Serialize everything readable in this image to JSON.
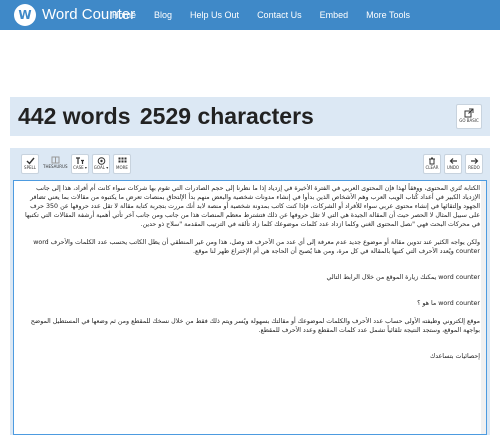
{
  "header": {
    "logo_letter": "W",
    "brand": "Word Counter",
    "nav": [
      "Home",
      "Blog",
      "Help Us Out",
      "Contact Us",
      "Embed",
      "More Tools"
    ]
  },
  "counter": {
    "words": "442 words",
    "characters": "2529 characters",
    "goto_label": "GO BASIC"
  },
  "toolbar": {
    "spell": "SPELL",
    "thesaurus": "THESAURUS",
    "case": "CASE ▾",
    "goal": "GOAL ▾",
    "more": "MORE",
    "clear": "CLEAR",
    "undo": "UNDO",
    "redo": "REDO"
  },
  "editor": {
    "p1": "الكتابة تُثري المحتوى، ووفقاً لهذا فإن المحتوى العربي في الفترة الأخيرة في إزدياد إذا ما نظرنا إلى حجم الصادرات التي تقوم بها شركات سواء كانت أم أفراد، هذا إلى جانب الإزدياد الكبير في أعداد كُتاب الويب العرب وهم الأشخاص الذين بدأوا في إنشاء مدونات شخصية والبعض منهم بدأ الإلتحاق بمنصات تعرض ما يكتبوه من مقالات بما يعني تضافر الجهود وإلتقائها في إنشاء محتوى عربي سواء للأفراد أو الشركات، فإذا كنت كاتب بمدونة شخصية أو منصة لابد أنك مررت بتجربة كتابة مقالة لا تقل عدد حروفها عن 350 حرف على سبيل المثال لا الحصر حيث أن المقالة الجيدة هي التي لا تقل حروفها عن ذلك فتشترط معظم المنصات هذا من جانب ومن جانب آخر تأتي أهمية أرشفة المقالات التي تكتبها في محركات البحث فهي \"نصل المحتوى الغني وكلما ازداد عدد كلمات موضوعك كلما زاد تألقه في الترتيب المقدمة \"سلاح ذو حدين.",
    "p2": "ولكن يواجه الكثير عند تدوين مقالة أو موضوع جديد عدم معرفة إلى أي عدد من الأحرف قد وصل، هذا ومن غير المنطقي أن يظل الكاتب يحسب عدد الكلمات والأحرف word counter ويُعدد الأحرف التي كتبها بالمقالة في كل مرة، ومن هنا يُصبح أن الحاجة هي أم الإختراع ظهر لنا موقع.",
    "p3": "word counter يمكنك زيارة الموقع من خلال الرابط التالي",
    "p4": "word counter ما هو ؟",
    "p5": "موقع إلكتروني وظيفته الأولى حساب عدد الأحرف والكلمات لموضوعك أو مقالتك بسهولة ويُسر ويتم ذلك فقط من خلال نسخك للمقطع ومن ثم وضعها في المستطيل الموضح بواجهة الموقع، وستجد النتيجة تلقائياً تشمل عدد كلمات المقطع وعدد الأحرف للمقطع.",
    "p6": "إحصائيات بتساعدك"
  }
}
